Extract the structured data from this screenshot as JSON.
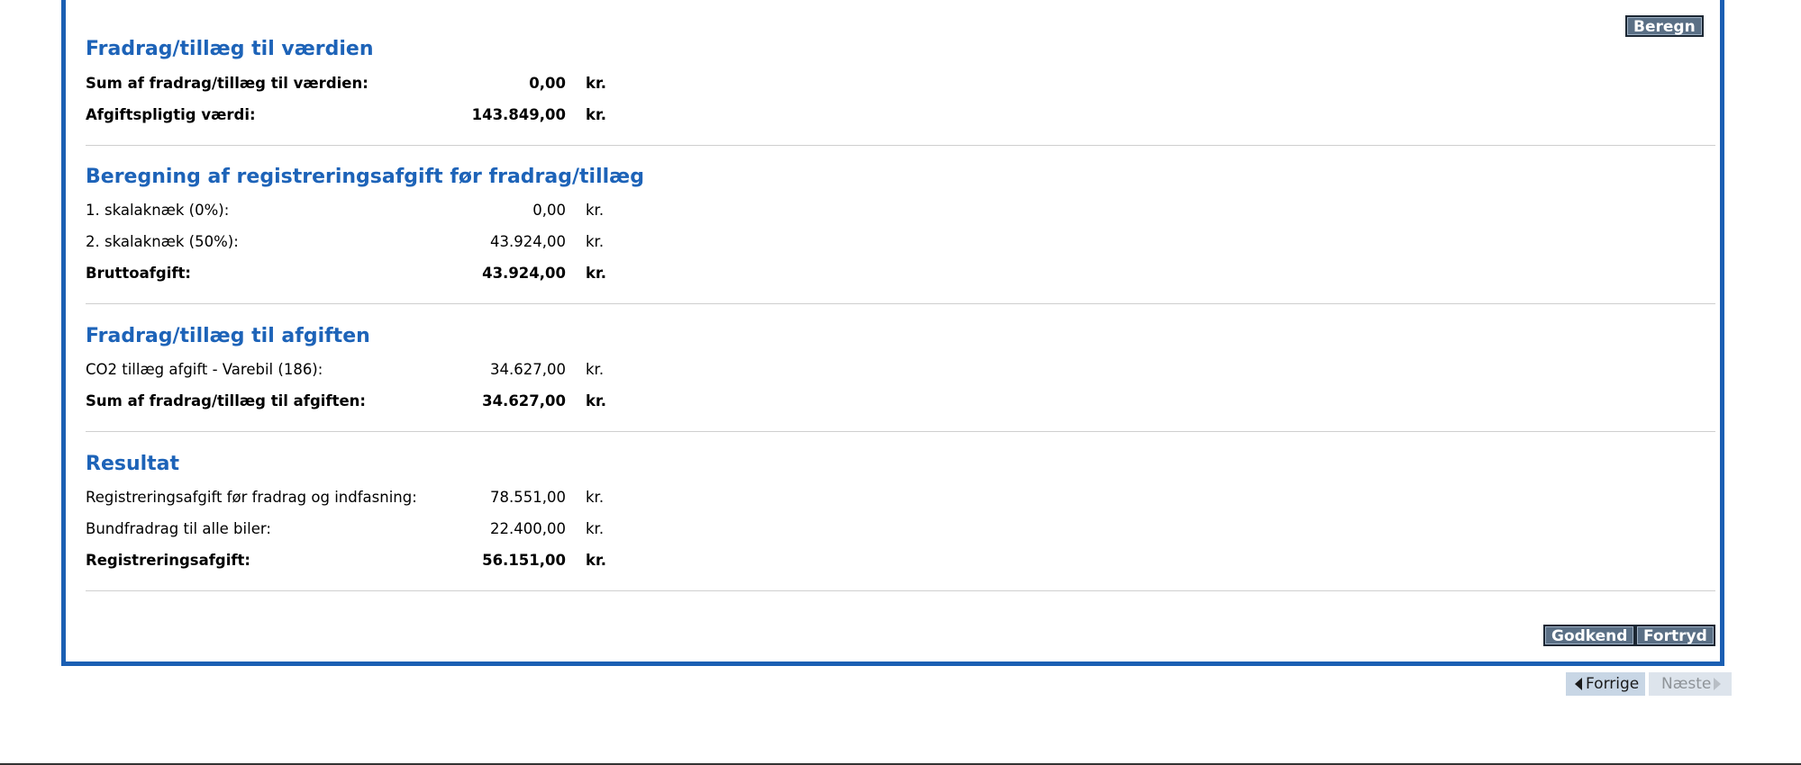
{
  "buttons": {
    "beregn": "Beregn",
    "godkend": "Godkend",
    "fortryd": "Fortryd"
  },
  "sections": {
    "fradrag_vaerdi": {
      "title": "Fradrag/tillæg til værdien",
      "rows": [
        {
          "label": "Sum af fradrag/tillæg til værdien:",
          "value": "0,00",
          "unit": "kr."
        },
        {
          "label": "Afgiftspligtig værdi:",
          "value": "143.849,00",
          "unit": "kr."
        }
      ]
    },
    "beregning": {
      "title": "Beregning af registreringsafgift før fradrag/tillæg",
      "rows": [
        {
          "label": "1. skalaknæk (0%):",
          "value": "0,00",
          "unit": "kr."
        },
        {
          "label": "2. skalaknæk (50%):",
          "value": "43.924,00",
          "unit": "kr."
        },
        {
          "label": "Bruttoafgift:",
          "value": "43.924,00",
          "unit": "kr."
        }
      ]
    },
    "fradrag_afgift": {
      "title": "Fradrag/tillæg til afgiften",
      "rows": [
        {
          "label": "CO2 tillæg afgift - Varebil (186):",
          "value": "34.627,00",
          "unit": "kr."
        },
        {
          "label": "Sum af fradrag/tillæg til afgiften:",
          "value": "34.627,00",
          "unit": "kr."
        }
      ]
    },
    "resultat": {
      "title": "Resultat",
      "rows": [
        {
          "label": "Registreringsafgift før fradrag og indfasning:",
          "value": "78.551,00",
          "unit": "kr."
        },
        {
          "label": "Bundfradrag til alle biler:",
          "value": "22.400,00",
          "unit": "kr."
        },
        {
          "label": "Registreringsafgift:",
          "value": "56.151,00",
          "unit": "kr."
        }
      ]
    }
  },
  "pager": {
    "prev": "Forrige",
    "next": "Næste"
  },
  "colors": {
    "accent": "#1b5fb3",
    "button_bg": "#5a6f85",
    "pager_active": "#c8d6e5",
    "pager_disabled": "#dde4ec"
  }
}
